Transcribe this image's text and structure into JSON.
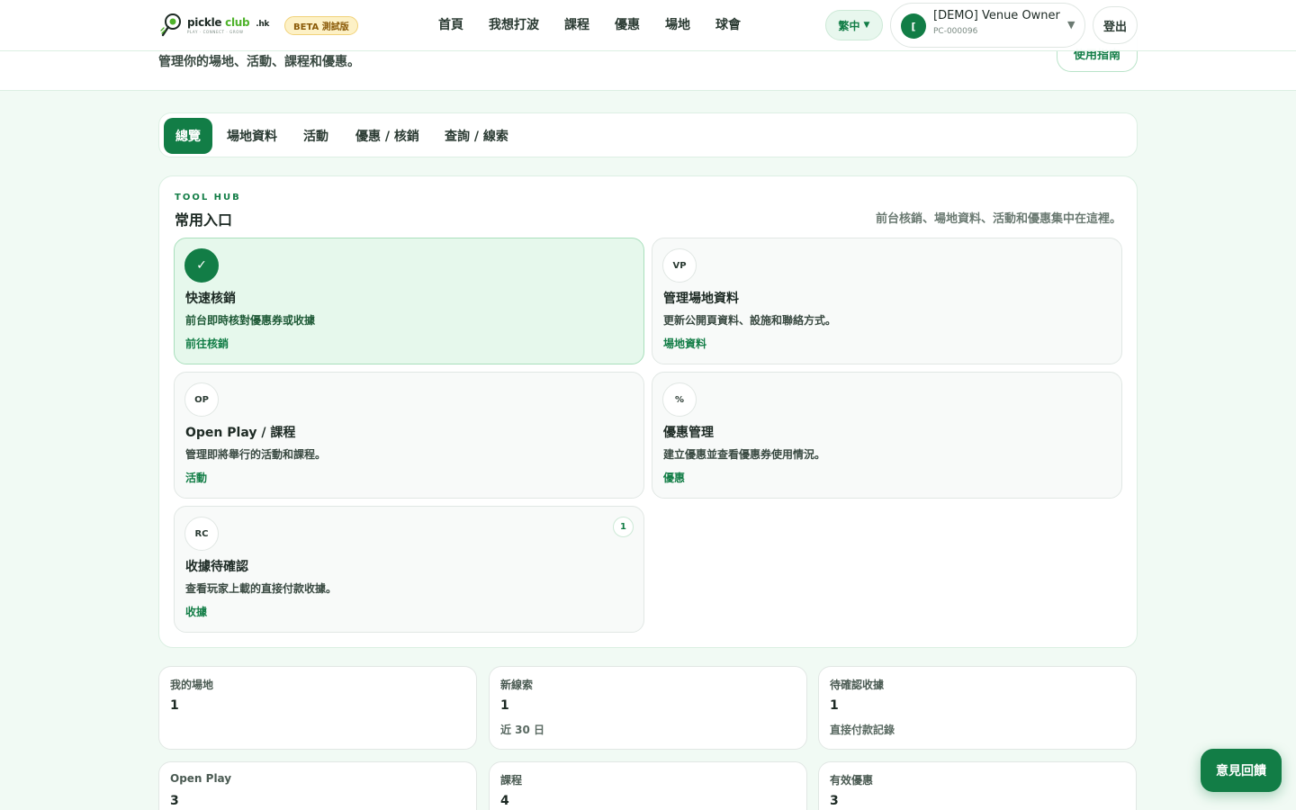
{
  "header": {
    "subtitle": "管理你的場地、活動、課程和優惠。",
    "guide_button": "使用指南"
  },
  "nav": {
    "logo": {
      "main": "pickle",
      "club": "club",
      "hk": ".hk",
      "tagline": "PLAY · CONNECT · GROW"
    },
    "beta_badge": "BETA 測試版",
    "links": [
      "首頁",
      "我想打波",
      "課程",
      "優惠",
      "場地",
      "球會"
    ],
    "language": {
      "label": "繁中",
      "caret": "▼"
    },
    "user": {
      "avatar_initial": "[",
      "name": "[DEMO] Venue Owner",
      "id": "PC-000096",
      "caret": "▼"
    },
    "logout": "登出"
  },
  "tabs": [
    {
      "label": "總覽",
      "active": true
    },
    {
      "label": "場地資料",
      "active": false
    },
    {
      "label": "活動",
      "active": false
    },
    {
      "label": "優惠 / 核銷",
      "active": false
    },
    {
      "label": "查詢 / 線索",
      "active": false
    }
  ],
  "tool_hub": {
    "kicker": "TOOL HUB",
    "title": "常用入口",
    "description": "前台核銷、場地資料、活動和優惠集中在這裡。",
    "cards": [
      {
        "icon": "✓",
        "icon_name": "check-icon",
        "title": "快速核銷",
        "desc": "前台即時核對優惠券或收據",
        "link": "前往核銷",
        "primary": true
      },
      {
        "icon": "VP",
        "icon_name": "venue-profile-icon",
        "title": "管理場地資料",
        "desc": "更新公開頁資料、設施和聯絡方式。",
        "link": "場地資料",
        "primary": false
      },
      {
        "icon": "OP",
        "icon_name": "open-play-icon",
        "title": "Open Play / 課程",
        "desc": "管理即將舉行的活動和課程。",
        "link": "活動",
        "primary": false
      },
      {
        "icon": "%",
        "icon_name": "percent-icon",
        "title": "優惠管理",
        "desc": "建立優惠並查看優惠券使用情況。",
        "link": "優惠",
        "primary": false
      },
      {
        "icon": "RC",
        "icon_name": "receipt-icon",
        "title": "收據待確認",
        "desc": "查看玩家上載的直接付款收據。",
        "link": "收據",
        "primary": false,
        "badge": "1"
      }
    ]
  },
  "stats": [
    {
      "label": "我的場地",
      "value": "1",
      "note": ""
    },
    {
      "label": "新線索",
      "value": "1",
      "note": "近 30 日"
    },
    {
      "label": "待確認收據",
      "value": "1",
      "note": "直接付款記錄"
    },
    {
      "label": "Open Play",
      "value": "3",
      "note": ""
    },
    {
      "label": "課程",
      "value": "4",
      "note": ""
    },
    {
      "label": "有效優惠",
      "value": "3",
      "note": ""
    }
  ],
  "feedback_button": "意見回饋",
  "colors": {
    "brand": "#127d46",
    "brand_light": "#e6f8ec",
    "background": "#f1faf4",
    "beta": "#fdf1c6"
  }
}
